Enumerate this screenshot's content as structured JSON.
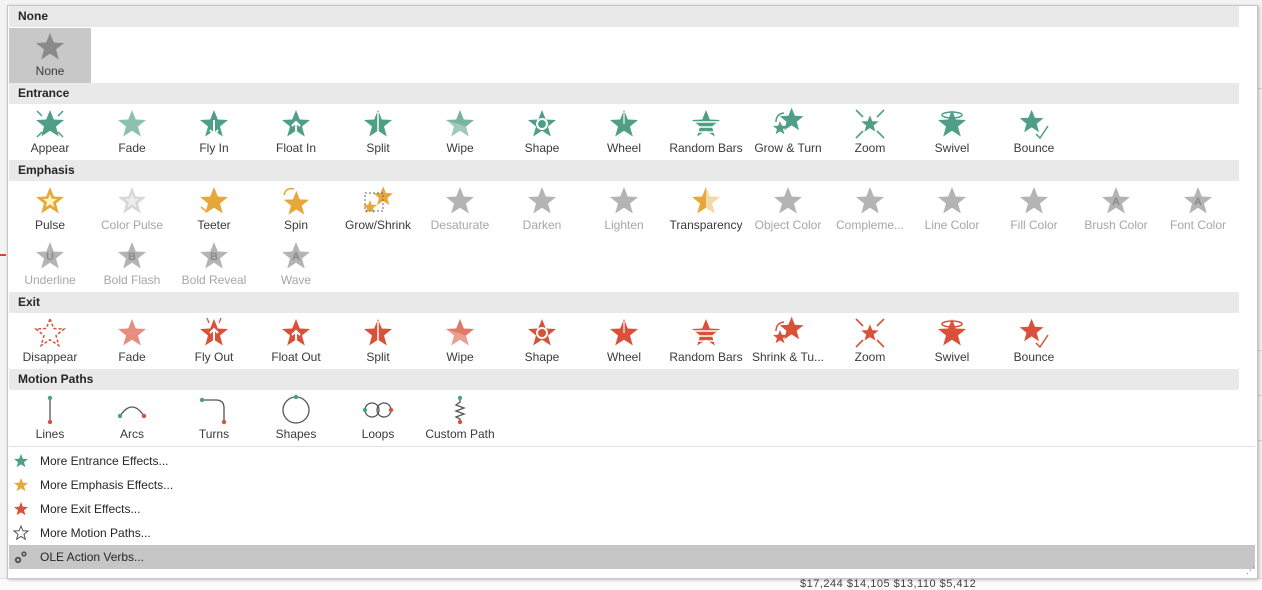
{
  "colors": {
    "entrance": "#4f9e86",
    "emphasis": "#e6a83a",
    "exit": "#d9513a",
    "disabled": "#b4b4b4",
    "path": "#555555"
  },
  "sections": {
    "none": {
      "title": "None",
      "items": [
        {
          "label": "None",
          "style": "none"
        }
      ]
    },
    "entrance": {
      "title": "Entrance",
      "items": [
        {
          "label": "Appear",
          "icon": "appear-icon"
        },
        {
          "label": "Fade",
          "icon": "fade-icon"
        },
        {
          "label": "Fly In",
          "icon": "fly-in-icon"
        },
        {
          "label": "Float In",
          "icon": "float-in-icon"
        },
        {
          "label": "Split",
          "icon": "split-icon"
        },
        {
          "label": "Wipe",
          "icon": "wipe-icon"
        },
        {
          "label": "Shape",
          "icon": "shape-icon"
        },
        {
          "label": "Wheel",
          "icon": "wheel-icon"
        },
        {
          "label": "Random Bars",
          "icon": "random-bars-icon"
        },
        {
          "label": "Grow & Turn",
          "icon": "grow-turn-icon"
        },
        {
          "label": "Zoom",
          "icon": "zoom-icon"
        },
        {
          "label": "Swivel",
          "icon": "swivel-icon"
        },
        {
          "label": "Bounce",
          "icon": "bounce-icon"
        }
      ]
    },
    "emphasis": {
      "title": "Emphasis",
      "items": [
        {
          "label": "Pulse",
          "enabled": true
        },
        {
          "label": "Color Pulse",
          "enabled": false
        },
        {
          "label": "Teeter",
          "enabled": true
        },
        {
          "label": "Spin",
          "enabled": true
        },
        {
          "label": "Grow/Shrink",
          "enabled": true
        },
        {
          "label": "Desaturate",
          "enabled": false
        },
        {
          "label": "Darken",
          "enabled": false
        },
        {
          "label": "Lighten",
          "enabled": false
        },
        {
          "label": "Transparency",
          "enabled": true
        },
        {
          "label": "Object Color",
          "enabled": false
        },
        {
          "label": "Compleme...",
          "enabled": false
        },
        {
          "label": "Line Color",
          "enabled": false
        },
        {
          "label": "Fill Color",
          "enabled": false
        },
        {
          "label": "Brush Color",
          "enabled": false,
          "letter": "A"
        },
        {
          "label": "Font Color",
          "enabled": false,
          "letter": "A"
        },
        {
          "label": "Underline",
          "enabled": false,
          "letter": "U"
        },
        {
          "label": "Bold Flash",
          "enabled": false,
          "letter": "B"
        },
        {
          "label": "Bold Reveal",
          "enabled": false,
          "letter": "B"
        },
        {
          "label": "Wave",
          "enabled": false,
          "letter": "A"
        }
      ]
    },
    "exit": {
      "title": "Exit",
      "items": [
        {
          "label": "Disappear"
        },
        {
          "label": "Fade"
        },
        {
          "label": "Fly Out"
        },
        {
          "label": "Float Out"
        },
        {
          "label": "Split"
        },
        {
          "label": "Wipe"
        },
        {
          "label": "Shape"
        },
        {
          "label": "Wheel"
        },
        {
          "label": "Random Bars"
        },
        {
          "label": "Shrink & Tu..."
        },
        {
          "label": "Zoom"
        },
        {
          "label": "Swivel"
        },
        {
          "label": "Bounce"
        }
      ]
    },
    "motion": {
      "title": "Motion Paths",
      "items": [
        {
          "label": "Lines",
          "icon": "lines-path-icon"
        },
        {
          "label": "Arcs",
          "icon": "arcs-path-icon"
        },
        {
          "label": "Turns",
          "icon": "turns-path-icon"
        },
        {
          "label": "Shapes",
          "icon": "shapes-path-icon"
        },
        {
          "label": "Loops",
          "icon": "loops-path-icon"
        },
        {
          "label": "Custom Path",
          "icon": "custom-path-icon"
        }
      ]
    }
  },
  "more": [
    {
      "label": "More Entrance Effects...",
      "icon": "entrance-star-icon"
    },
    {
      "label": "More Emphasis Effects...",
      "icon": "emphasis-star-icon"
    },
    {
      "label": "More Exit Effects...",
      "icon": "exit-star-icon"
    },
    {
      "label": "More Motion Paths...",
      "icon": "motion-star-outline-icon"
    },
    {
      "label": "OLE Action Verbs...",
      "icon": "gears-icon"
    }
  ],
  "background_numbers": "$17,244   $14,105   $13,110   $5,412"
}
